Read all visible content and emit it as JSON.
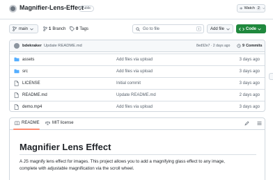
{
  "header": {
    "repo_name": "Magnifier-Lens-Effect",
    "visibility": "Public",
    "watch_label": "Watch",
    "watch_count": "2"
  },
  "toolbar": {
    "branch": "main",
    "branches_count": "1",
    "branches_label": "Branch",
    "tags_count": "0",
    "tags_label": "Tags",
    "goto_placeholder": "Go to file",
    "goto_shortcut": "t",
    "add_file_label": "Add file",
    "code_label": "Code"
  },
  "latest_commit": {
    "author": "bdekraker",
    "message": "Update README.md",
    "meta": "8ed92e7 · 2 days ago",
    "commits_count": "9",
    "commits_label": "Commits"
  },
  "files": [
    {
      "name": "assets",
      "type": "folder",
      "message": "Add files via upload",
      "date": "3 days ago"
    },
    {
      "name": "src",
      "type": "folder",
      "message": "Add files via upload",
      "date": "3 days ago"
    },
    {
      "name": "LICENSE",
      "type": "file",
      "message": "Initial commit",
      "date": "3 days ago"
    },
    {
      "name": "README.md",
      "type": "file",
      "message": "Update README.md",
      "date": "2 days ago"
    },
    {
      "name": "demo.mp4",
      "type": "file",
      "message": "Add files via upload",
      "date": "3 days ago"
    }
  ],
  "readme": {
    "tab_readme": "README",
    "tab_license": "MIT license",
    "title": "Magnifier Lens Effect",
    "paragraph_line1": "A JS magnify lens effect for images. This project allows you to add a magnifying glass effect to any image,",
    "paragraph_line2": "complete with adjustable magnification via the scroll wheel."
  },
  "colors": {
    "accent_green": "#1f883d",
    "folder_blue": "#54aeff",
    "tab_underline": "#fd8c73"
  }
}
